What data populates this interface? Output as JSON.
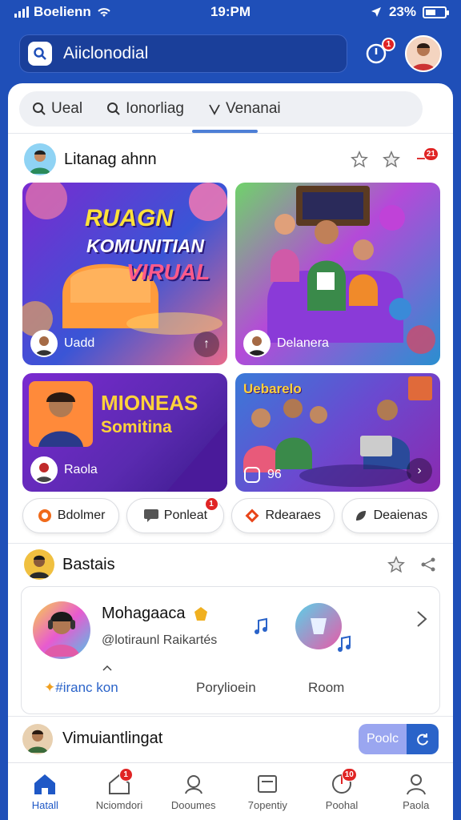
{
  "status_bar": {
    "carrier": "Boelienn",
    "time": "19:PM",
    "battery": "23%"
  },
  "header": {
    "search_label": "Aiiclonodial",
    "bell_badge": "1"
  },
  "tabs": [
    {
      "label": "Ueal",
      "icon": "search-icon"
    },
    {
      "label": "Ionorliag",
      "icon": "search-icon"
    },
    {
      "label": "Venanai",
      "icon": "check-icon"
    }
  ],
  "section1": {
    "title": "Litanag ahnn",
    "badge": "21",
    "cards": [
      {
        "headline_1": "RUAGN",
        "headline_2": "KOMUNITIAN",
        "headline_3": "VIRUAL",
        "caption": "Uadd"
      },
      {
        "caption": "Delanera"
      },
      {
        "headline_1": "MIONEAS",
        "headline_2": "Somitina",
        "caption": "Raola"
      },
      {
        "headline_1": "Uebarelo",
        "caption": "96"
      }
    ]
  },
  "chips": [
    {
      "label": "Bdolmer",
      "icon": "flame-icon"
    },
    {
      "label": "Ponleat",
      "icon": "chat-icon",
      "badge": "1"
    },
    {
      "label": "Rdearaes",
      "icon": "diamond-icon"
    },
    {
      "label": "Deaienas",
      "icon": "leaf-icon"
    }
  ],
  "section2": {
    "title": "Bastais",
    "featured": {
      "name": "Mohagaaca",
      "handle": "@lotiraunl Raikartés",
      "tag": "#iranc kon",
      "col2": "Porylioein",
      "col3": "Room"
    }
  },
  "bottom_row": {
    "title": "Vimuiantlingat",
    "button_label": "Poolc"
  },
  "nav": [
    {
      "label": "Hatall",
      "icon": "home-icon",
      "active": true
    },
    {
      "label": "Nciomdori",
      "icon": "house-icon",
      "badge": "1"
    },
    {
      "label": "Dooumes",
      "icon": "profile-icon"
    },
    {
      "label": "7opentiy",
      "icon": "calendar-icon"
    },
    {
      "label": "Poohal",
      "icon": "chart-icon",
      "badge": "10"
    },
    {
      "label": "Paola",
      "icon": "user-icon"
    }
  ],
  "colors": {
    "brand": "#1f4fb8",
    "accent": "#2a63c9",
    "badge": "#e02424"
  }
}
